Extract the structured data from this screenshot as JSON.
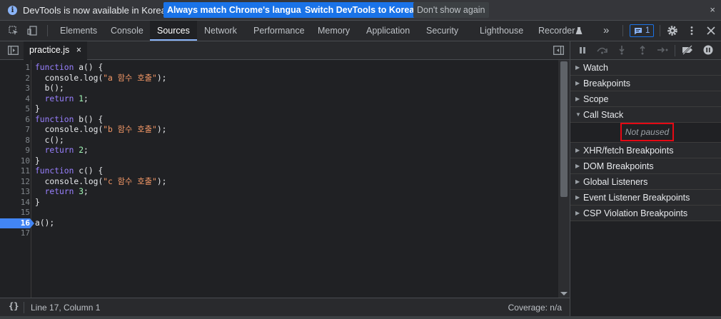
{
  "infobar": {
    "icon": "info-icon",
    "message": "DevTools is now available in Korean!",
    "btn_match": "Always match Chrome's language",
    "btn_switch": "Switch DevTools to Korean",
    "btn_dismiss": "Don't show again",
    "close": "×"
  },
  "tabs": [
    "Elements",
    "Console",
    "Sources",
    "Network",
    "Performance",
    "Memory",
    "Application",
    "Security",
    "Lighthouse",
    "Recorder"
  ],
  "active_tab": "Sources",
  "more_tabs": "»",
  "messages_count": "1",
  "file_tab": {
    "name": "practice.js",
    "close": "×"
  },
  "code_lines": [
    "function a() {",
    "  console.log(\"a 함수 호출\");",
    "  b();",
    "  return 1;",
    "}",
    "function b() {",
    "  console.log(\"b 함수 호출\");",
    "  c();",
    "  return 2;",
    "}",
    "function c() {",
    "  console.log(\"c 함수 호출\");",
    "  return 3;",
    "}",
    "",
    "a();",
    ""
  ],
  "line_numbers": [
    "1",
    "2",
    "3",
    "4",
    "5",
    "6",
    "7",
    "8",
    "9",
    "10",
    "11",
    "12",
    "13",
    "14",
    "15",
    "16",
    "17"
  ],
  "breakpoint_line": "16",
  "status": {
    "braces": "{}",
    "position": "Line 17, Column 1",
    "coverage": "Coverage: n/a"
  },
  "debugger_sections": {
    "watch": "Watch",
    "breakpoints": "Breakpoints",
    "scope": "Scope",
    "call_stack": "Call Stack",
    "not_paused": "Not paused",
    "xhr": "XHR/fetch Breakpoints",
    "dom": "DOM Breakpoints",
    "global": "Global Listeners",
    "event": "Event Listener Breakpoints",
    "csp": "CSP Violation Breakpoints"
  },
  "colors": {
    "accent": "#8ab4f8",
    "primary_button": "#1a73e8",
    "breakpoint": "#4285f4",
    "highlight_box": "#e50914"
  }
}
